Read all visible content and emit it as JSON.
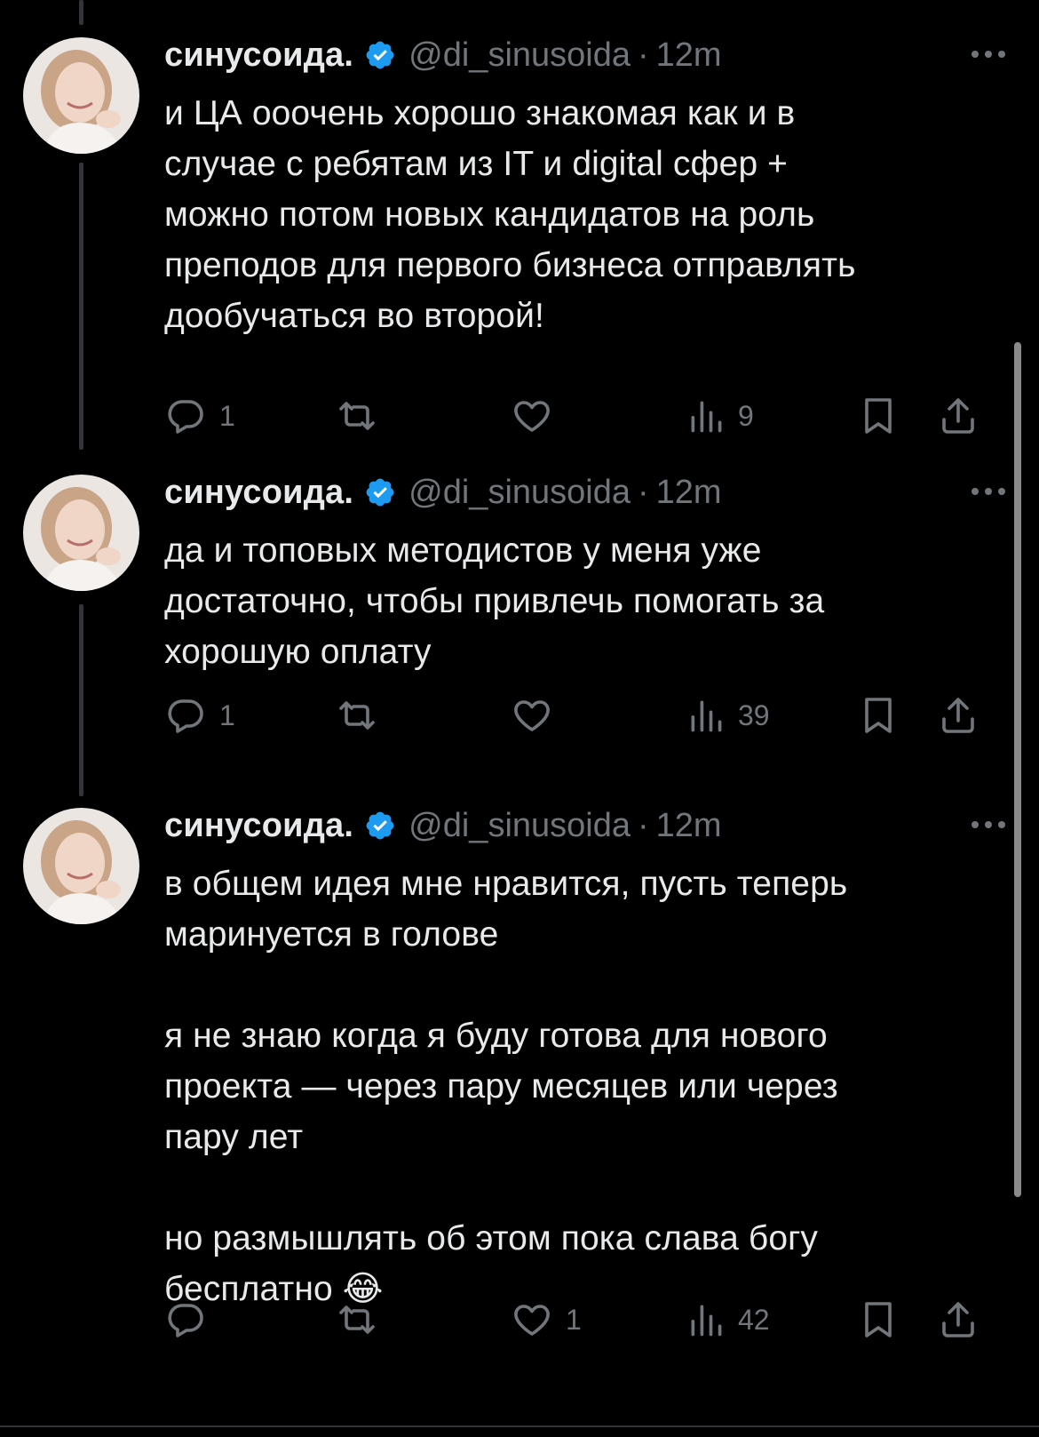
{
  "user": {
    "display_name": "синусоида.",
    "handle": "@di_sinusoida",
    "separator": "·",
    "verified_color": "#1d9bf0"
  },
  "tweets": [
    {
      "time": "12m",
      "text": "и ЦА ооочень хорошо знакомая как и в\nслучае с ребятам из IT и digital сфер +\nможно потом новых кандидатов на роль\nпреподов для первого бизнеса отправлять\nдообучаться во второй!",
      "replies": "1",
      "reposts": "",
      "likes": "",
      "views": "9"
    },
    {
      "time": "12m",
      "text": "да и топовых методистов у меня уже\nдостаточно, чтобы привлечь помогать за\nхорошую оплату",
      "replies": "1",
      "reposts": "",
      "likes": "",
      "views": "39"
    },
    {
      "time": "12m",
      "text": "в общем идея мне нравится, пусть теперь\nмаринуется в голове\n\nя не знаю когда я буду готова для нового\nпроекта — через пару месяцев или через\nпару лет\n\nно размышлять об этом пока слава богу\nбесплатно 😂",
      "replies": "",
      "reposts": "",
      "likes": "1",
      "views": "42"
    }
  ],
  "icons": {
    "reply": "reply-icon",
    "repost": "repost-icon",
    "like": "heart-icon",
    "views": "views-icon",
    "bookmark": "bookmark-icon",
    "share": "share-icon",
    "more": "more-icon",
    "verified": "verified-badge-icon"
  },
  "colors": {
    "background": "#000000",
    "text": "#e7e9ea",
    "muted": "#71767b",
    "thread_line": "#333639"
  }
}
